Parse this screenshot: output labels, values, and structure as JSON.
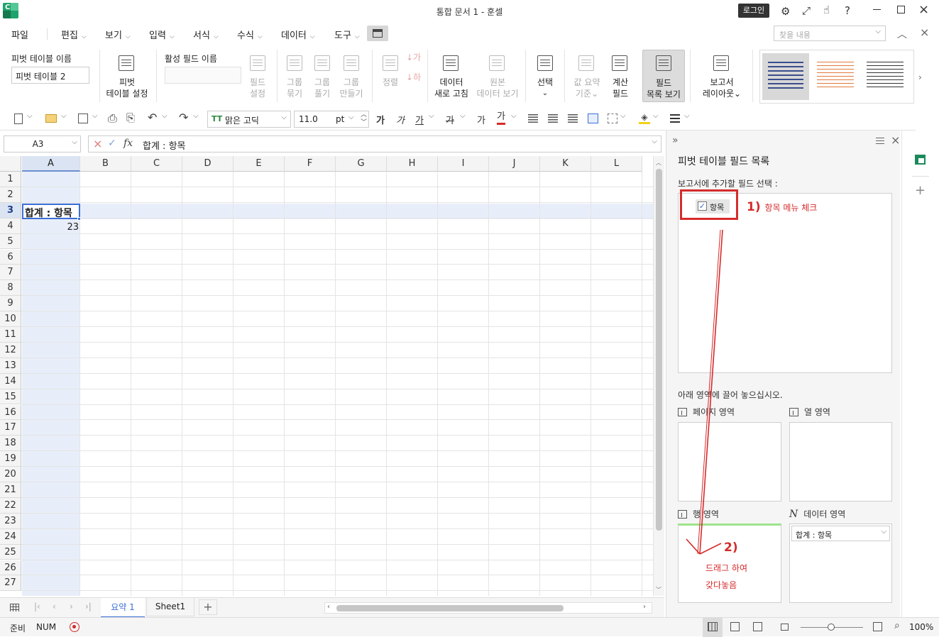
{
  "window": {
    "title": "통합 문서 1 - 훈셀",
    "login_label": "로그인"
  },
  "menubar": {
    "items": [
      "파일",
      "편집",
      "보기",
      "입력",
      "서식",
      "수식",
      "데이터",
      "도구"
    ],
    "search_placeholder": "찾을 내용"
  },
  "ribbon": {
    "pivot_name_label": "피벗 테이블 이름",
    "pivot_name_value": "피벗 테이블 2",
    "active_field_label": "활성 필드 이름",
    "active_field_value": "",
    "buttons": [
      {
        "line1": "피벗",
        "line2": "테이블 설정",
        "enabled": true
      },
      {
        "line1": "필드",
        "line2": "설정",
        "enabled": false
      },
      {
        "line1": "그룹",
        "line2": "묶기",
        "enabled": false
      },
      {
        "line1": "그룹",
        "line2": "풀기",
        "enabled": false
      },
      {
        "line1": "그룹",
        "line2": "만들기",
        "enabled": false
      },
      {
        "line1": "정렬",
        "line2": "",
        "enabled": false
      },
      {
        "line1": "데이터",
        "line2": "새로 고침",
        "enabled": true
      },
      {
        "line1": "원본",
        "line2": "데이터 보기",
        "enabled": false
      },
      {
        "line1": "선택",
        "line2": "⌄",
        "enabled": true
      },
      {
        "line1": "값 요약",
        "line2": "기준⌄",
        "enabled": false
      },
      {
        "line1": "계산",
        "line2": "필드",
        "enabled": true
      },
      {
        "line1": "필드",
        "line2": "목록 보기",
        "enabled": true
      },
      {
        "line1": "보고서",
        "line2": "레이아웃⌄",
        "enabled": true
      }
    ]
  },
  "toolbar": {
    "font_name": "맑은 고딕",
    "font_size": "11.0",
    "font_unit": "pt",
    "bold": "가",
    "italic": "가",
    "underline": "가",
    "strike": "가",
    "super": "가",
    "font_color_glyph": "가"
  },
  "formula": {
    "cell_ref": "A3",
    "content": "합계 : 항목"
  },
  "sheet": {
    "columns": [
      "A",
      "B",
      "C",
      "D",
      "E",
      "F",
      "G",
      "H",
      "I",
      "J",
      "K",
      "L"
    ],
    "rows": [
      "1",
      "2",
      "3",
      "4",
      "5",
      "6",
      "7",
      "8",
      "9",
      "10",
      "11",
      "12",
      "13",
      "14",
      "15",
      "16",
      "17",
      "18",
      "19",
      "20",
      "21",
      "22",
      "23",
      "24",
      "25",
      "26",
      "27"
    ],
    "a3": "합계 : 항목",
    "a4": "23"
  },
  "tabs": {
    "sheets": [
      "요약 1",
      "Sheet1"
    ],
    "active": "요약 1"
  },
  "status": {
    "ready": "준비",
    "num": "NUM",
    "zoom": "100%"
  },
  "panel": {
    "title": "피벗 테이블 필드 목록",
    "field_select_label": "보고서에 추가할 필드 선택 :",
    "field_item": "항목",
    "drag_hint": "아래 영역에 끌어 놓으십시오.",
    "page_area": "페이지 영역",
    "col_area": "열 영역",
    "row_area": "행 영역",
    "data_area": "데이터 영역",
    "data_area_item": "합계 : 항목"
  },
  "annotations": {
    "step1_num": "1)",
    "step1_text": "항목 메뉴 체크",
    "step2_num": "2)",
    "step2_line1": "드래그 하여",
    "step2_line2": "갖다놓음"
  },
  "colors": {
    "accent": "#1a8a5a",
    "annotation": "#d62b2b",
    "selection": "#dbe4f3"
  }
}
